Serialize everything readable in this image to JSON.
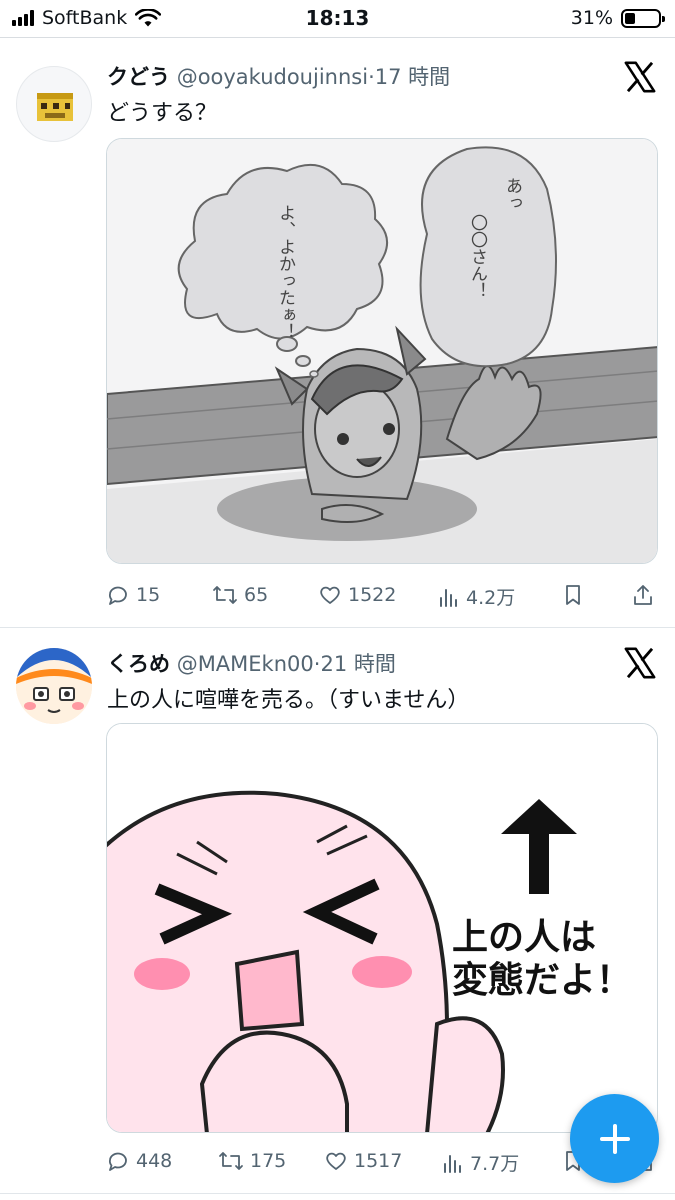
{
  "status_bar": {
    "carrier": "SoftBank",
    "time": "18:13",
    "battery_text": "31%",
    "battery_level": 0.31,
    "icons": [
      "signal-icon",
      "wifi-icon",
      "battery-icon"
    ]
  },
  "tweets": [
    {
      "display_name": "クどう",
      "handle": "@ooyakudoujinnsi",
      "separator": "·",
      "time": "17 時間",
      "text": "どうする？",
      "media_text": {
        "bubble_left": "よ、よかったぁ！",
        "bubble_right_1": "あっ",
        "bubble_right_2": "〇〇さん！"
      },
      "actions": {
        "replies": "15",
        "retweets": "65",
        "likes": "1522",
        "views": "4.2万"
      }
    },
    {
      "display_name": "くろめ",
      "handle": "@MAMEkn00",
      "separator": "·",
      "time": "21 時間",
      "text": "上の人に喧嘩を売る。（すいません）",
      "media_text": {
        "line1": "上の人は",
        "line2": "変態だよ！"
      },
      "actions": {
        "replies": "448",
        "retweets": "175",
        "likes": "1517",
        "views": "7.7万"
      }
    }
  ],
  "colors": {
    "accent": "#1d9bf0",
    "secondary_text": "#536471",
    "primary_text": "#0f1419"
  },
  "fab": {
    "icon": "plus-icon"
  }
}
